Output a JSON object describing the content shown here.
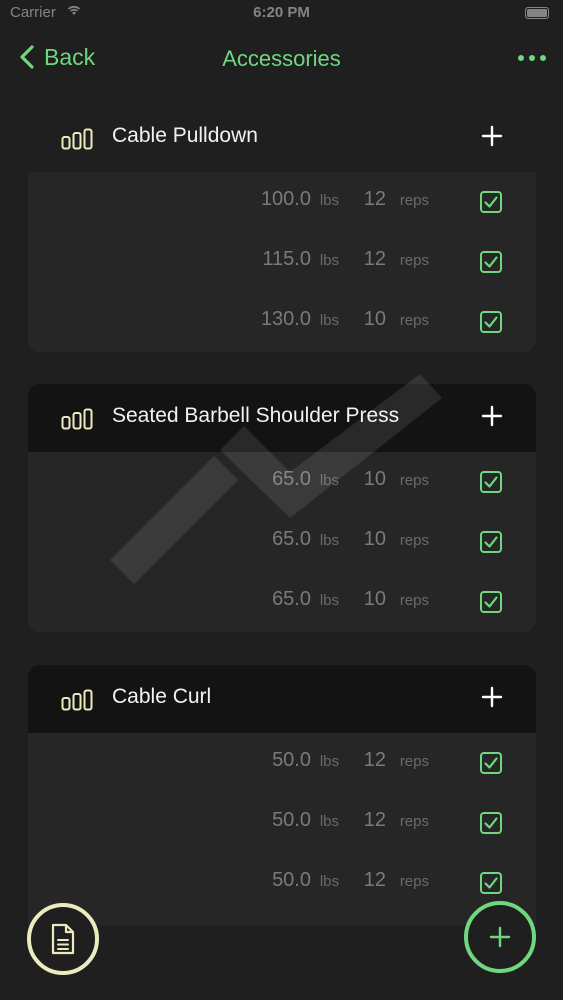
{
  "status_bar": {
    "carrier": "Carrier",
    "time": "6:20 PM"
  },
  "nav": {
    "back_label": "Back",
    "title": "Accessories"
  },
  "colors": {
    "accent": "#6fd77f",
    "notes_ring": "#ecebc0",
    "background": "#1f1f1f"
  },
  "exercises": [
    {
      "name": "Cable Pulldown",
      "sets": [
        {
          "weight": "100.0",
          "weight_unit": "lbs",
          "reps": "12",
          "reps_unit": "reps",
          "done": true
        },
        {
          "weight": "115.0",
          "weight_unit": "lbs",
          "reps": "12",
          "reps_unit": "reps",
          "done": true
        },
        {
          "weight": "130.0",
          "weight_unit": "lbs",
          "reps": "10",
          "reps_unit": "reps",
          "done": true
        }
      ]
    },
    {
      "name": "Seated Barbell Shoulder Press",
      "sets": [
        {
          "weight": "65.0",
          "weight_unit": "lbs",
          "reps": "10",
          "reps_unit": "reps",
          "done": true
        },
        {
          "weight": "65.0",
          "weight_unit": "lbs",
          "reps": "10",
          "reps_unit": "reps",
          "done": true
        },
        {
          "weight": "65.0",
          "weight_unit": "lbs",
          "reps": "10",
          "reps_unit": "reps",
          "done": true
        }
      ]
    },
    {
      "name": "Cable Curl",
      "sets": [
        {
          "weight": "50.0",
          "weight_unit": "lbs",
          "reps": "12",
          "reps_unit": "reps",
          "done": true
        },
        {
          "weight": "50.0",
          "weight_unit": "lbs",
          "reps": "12",
          "reps_unit": "reps",
          "done": true
        },
        {
          "weight": "50.0",
          "weight_unit": "lbs",
          "reps": "12",
          "reps_unit": "reps",
          "done": true
        }
      ]
    }
  ],
  "icons": {
    "back": "chevron-left-icon",
    "more": "ellipsis-icon",
    "exercise": "bar-chart-icon",
    "add": "plus-icon",
    "check": "checkbox-checked-icon",
    "notes": "document-icon"
  }
}
